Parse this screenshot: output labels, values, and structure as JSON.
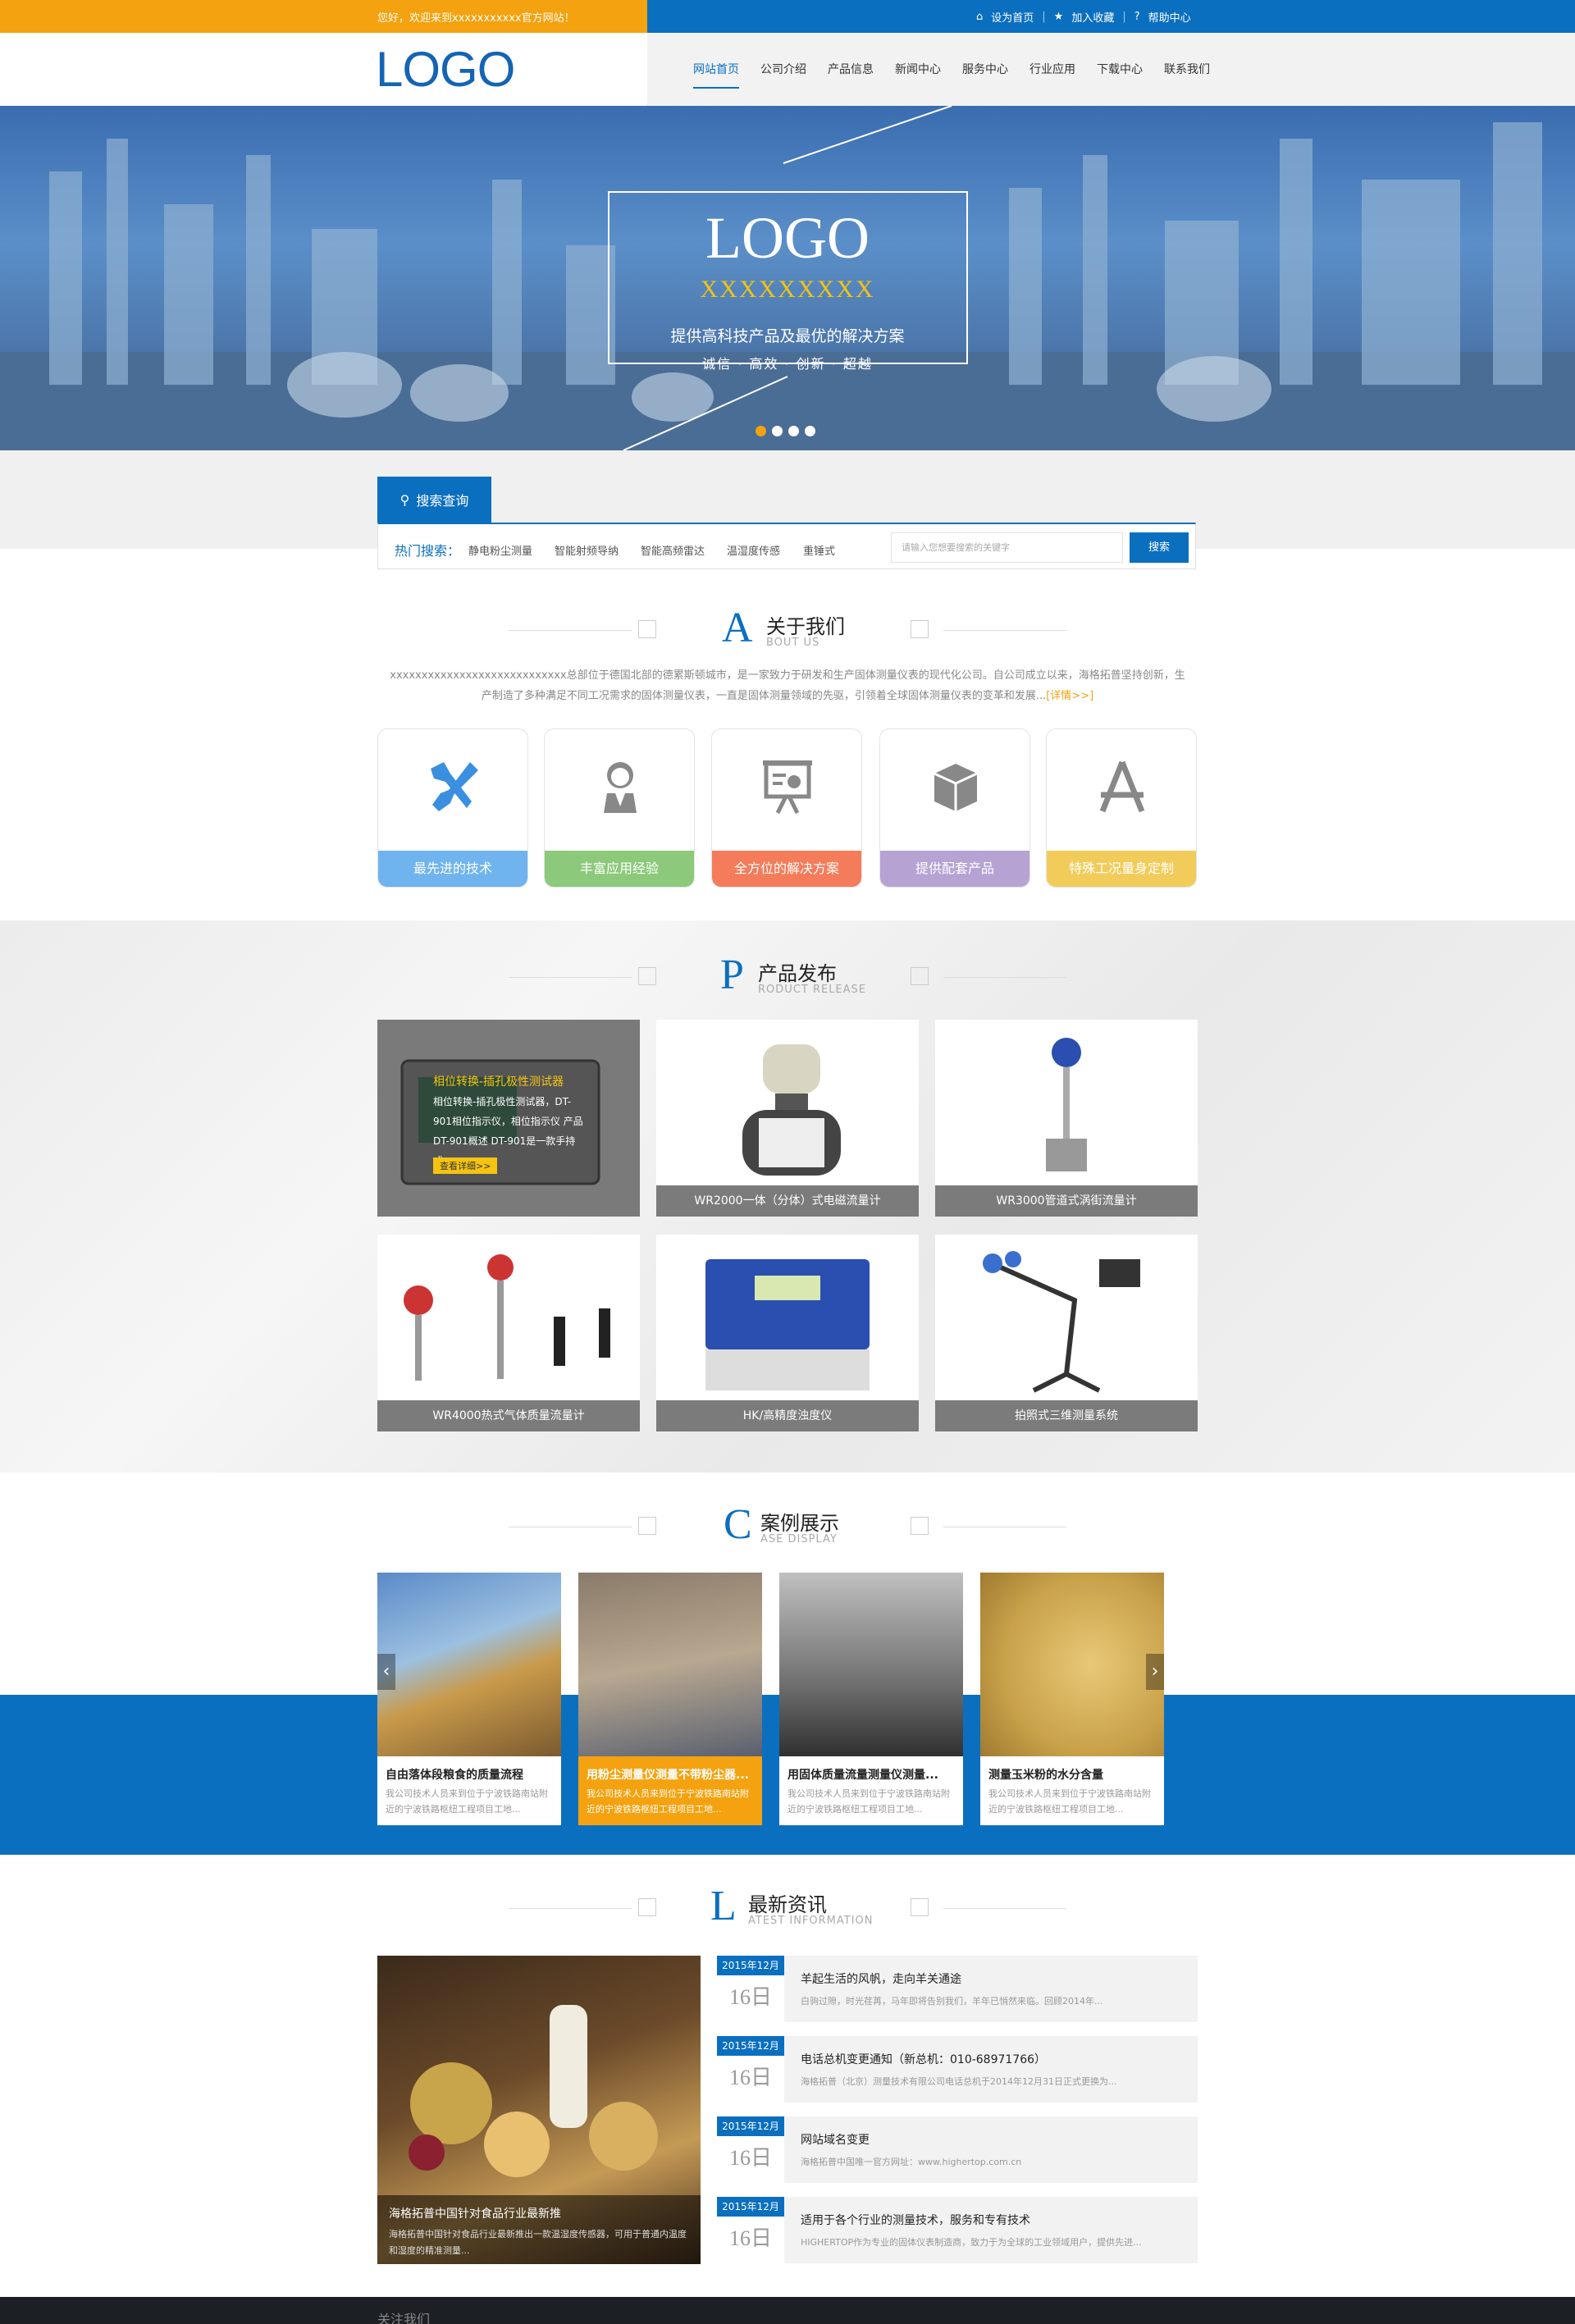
{
  "topbar": {
    "welcome": "您好，欢迎来到xxxxxxxxxxx官方网站！",
    "set_home": "设为首页",
    "favorite": "加入收藏",
    "help": "帮助中心"
  },
  "header": {
    "logo": "LOGO",
    "nav": [
      "网站首页",
      "公司介绍",
      "产品信息",
      "新闻中心",
      "服务中心",
      "行业应用",
      "下载中心",
      "联系我们"
    ]
  },
  "banner": {
    "logo": "LOGO",
    "subtitle": "XXXXXXXXX",
    "slogan": "提供高科技产品及最优的解决方案",
    "values": "诚信 · 高效 · 创新 · 超越"
  },
  "search": {
    "tab_label": "搜索查询",
    "hot_label": "热门搜索：",
    "keywords": [
      "静电粉尘测量",
      "智能射频导纳",
      "智能高频雷达",
      "温湿度传感",
      "重锤式"
    ],
    "placeholder": "请输入您想要搜索的关键字",
    "button": "搜索"
  },
  "about": {
    "letter": "A",
    "title": "关于我们",
    "subtitle": "BOUT US",
    "text": "xxxxxxxxxxxxxxxxxxxxxxxxxxxx总部位于德国北部的德累斯顿城市，是一家致力于研发和生产固体测量仪表的现代化公司。自公司成立以来，海格拓普坚持创新，生产制造了多种满足不同工况需求的固体测量仪表，一直是固体测量领域的先驱，引领着全球固体测量仪表的变革和发展...",
    "more": "[详情>>]",
    "features": [
      {
        "label": "最先进的技术",
        "color": "#6fb4ee",
        "icon": "tools-icon"
      },
      {
        "label": "丰富应用经验",
        "color": "#8cc97a",
        "icon": "person-icon"
      },
      {
        "label": "全方位的解决方案",
        "color": "#f47c5a",
        "icon": "presentation-icon"
      },
      {
        "label": "提供配套产品",
        "color": "#b6a3d4",
        "icon": "box-icon"
      },
      {
        "label": "特殊工况量身定制",
        "color": "#f2cc5a",
        "icon": "appstore-icon"
      }
    ]
  },
  "products": {
    "letter": "P",
    "title": "产品发布",
    "subtitle": "RODUCT RELEASE",
    "featured": {
      "title": "相位转换-插孔极性测试器",
      "desc": "相位转换-插孔极性测试器，DT-901相位指示仪，相位指示仪 产品DT-901概述 DT-901是一款手持式...",
      "button": "查看详细>>"
    },
    "items": [
      "WR2000一体（分体）式电磁流量计",
      "WR3000管道式涡街流量计",
      "WR4000热式气体质量流量计",
      "HK/高精度浊度仪",
      "拍照式三维测量系统"
    ]
  },
  "cases": {
    "letter": "C",
    "title": "案例展示",
    "subtitle": "ASE DISPLAY",
    "items": [
      {
        "title": "自由落体段粮食的质量流程",
        "desc": "我公司技术人员来到位于宁波铁路南站附近的宁波铁路枢纽工程项目工地..."
      },
      {
        "title": "用粉尘测量仪测量不带粉尘器...",
        "desc": "我公司技术人员来到位于宁波铁路南站附近的宁波铁路枢纽工程项目工地..."
      },
      {
        "title": "用固体质量流量测量仪测量...",
        "desc": "我公司技术人员来到位于宁波铁路南站附近的宁波铁路枢纽工程项目工地..."
      },
      {
        "title": "测量玉米粉的水分含量",
        "desc": "我公司技术人员来到位于宁波铁路南站附近的宁波铁路枢纽工程项目工地..."
      }
    ]
  },
  "news": {
    "letter": "L",
    "title": "最新资讯",
    "subtitle": "ATEST INFORMATION",
    "featured": {
      "title": "海格拓普中国针对食品行业最新推",
      "desc": "海格拓普中国针对食品行业最新推出一款温湿度传感器，可用于普通内温度和湿度的精准测量..."
    },
    "items": [
      {
        "month": "2015年12月",
        "day": "16日",
        "title": "羊起生活的风帆，走向羊关通途",
        "desc": "白驹过隙，时光荏苒，马年即将告别我们，羊年已悄然来临。回顾2014年..."
      },
      {
        "month": "2015年12月",
        "day": "16日",
        "title": "电话总机变更通知（新总机：010-68971766）",
        "desc": "海格拓普（北京）测量技术有限公司电话总机于2014年12月31日正式更换为..."
      },
      {
        "month": "2015年12月",
        "day": "16日",
        "title": "网站域名变更",
        "desc": "海格拓普中国唯一官方网址：www.highertop.com.cn"
      },
      {
        "month": "2015年12月",
        "day": "16日",
        "title": "适用于各个行业的测量技术，服务和专有技术",
        "desc": "HIGHERTOP作为专业的固体仪表制造商，致力于为全球的工业领域用户，提供先进..."
      }
    ]
  },
  "footer": {
    "label": "关注我们"
  }
}
